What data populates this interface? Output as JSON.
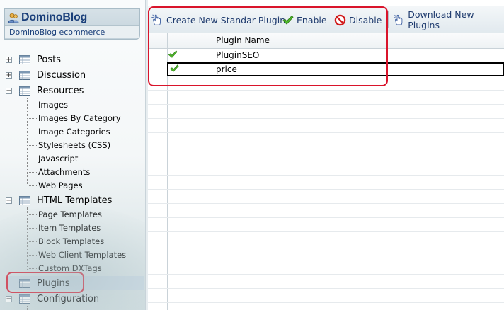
{
  "brand": {
    "title": "DominoBlog",
    "subtitle": "DominoBlog ecommerce"
  },
  "tree": {
    "posts": "Posts",
    "discussion": "Discussion",
    "resources": "Resources",
    "resources_children": [
      "Images",
      "Images By Category",
      "Image Categories",
      "Stylesheets (CSS)",
      "Javascript",
      "Attachments",
      "Web Pages"
    ],
    "html_templates": "HTML Templates",
    "html_templates_children": [
      "Page Templates",
      "Item Templates",
      "Block Templates",
      "Web Client Templates",
      "Custom DXTags"
    ],
    "plugins": "Plugins",
    "configuration": "Configuration",
    "expander_plus": "+",
    "expander_minus": "−"
  },
  "toolbar": {
    "create_label": "Create New Standar Plugin",
    "enable_label": "Enable",
    "disable_label": "Disable",
    "download_label": "Download New Plugins"
  },
  "grid": {
    "column_header": "Plugin Name",
    "rows": [
      {
        "name": "PluginSEO",
        "enabled": true,
        "selected": false
      },
      {
        "name": "price",
        "enabled": true,
        "selected": true
      }
    ]
  },
  "colors": {
    "highlight": "#d9142b",
    "brand_text": "#1a3f7a",
    "toolbar_text": "#1f3b6e",
    "check_green": "#3aa61e"
  },
  "icons": {
    "brand": "users-icon",
    "tree_item": "table-icon",
    "create": "hand-pointer-icon",
    "enable": "check-icon",
    "disable": "no-entry-icon",
    "download": "hand-pointer-icon"
  }
}
